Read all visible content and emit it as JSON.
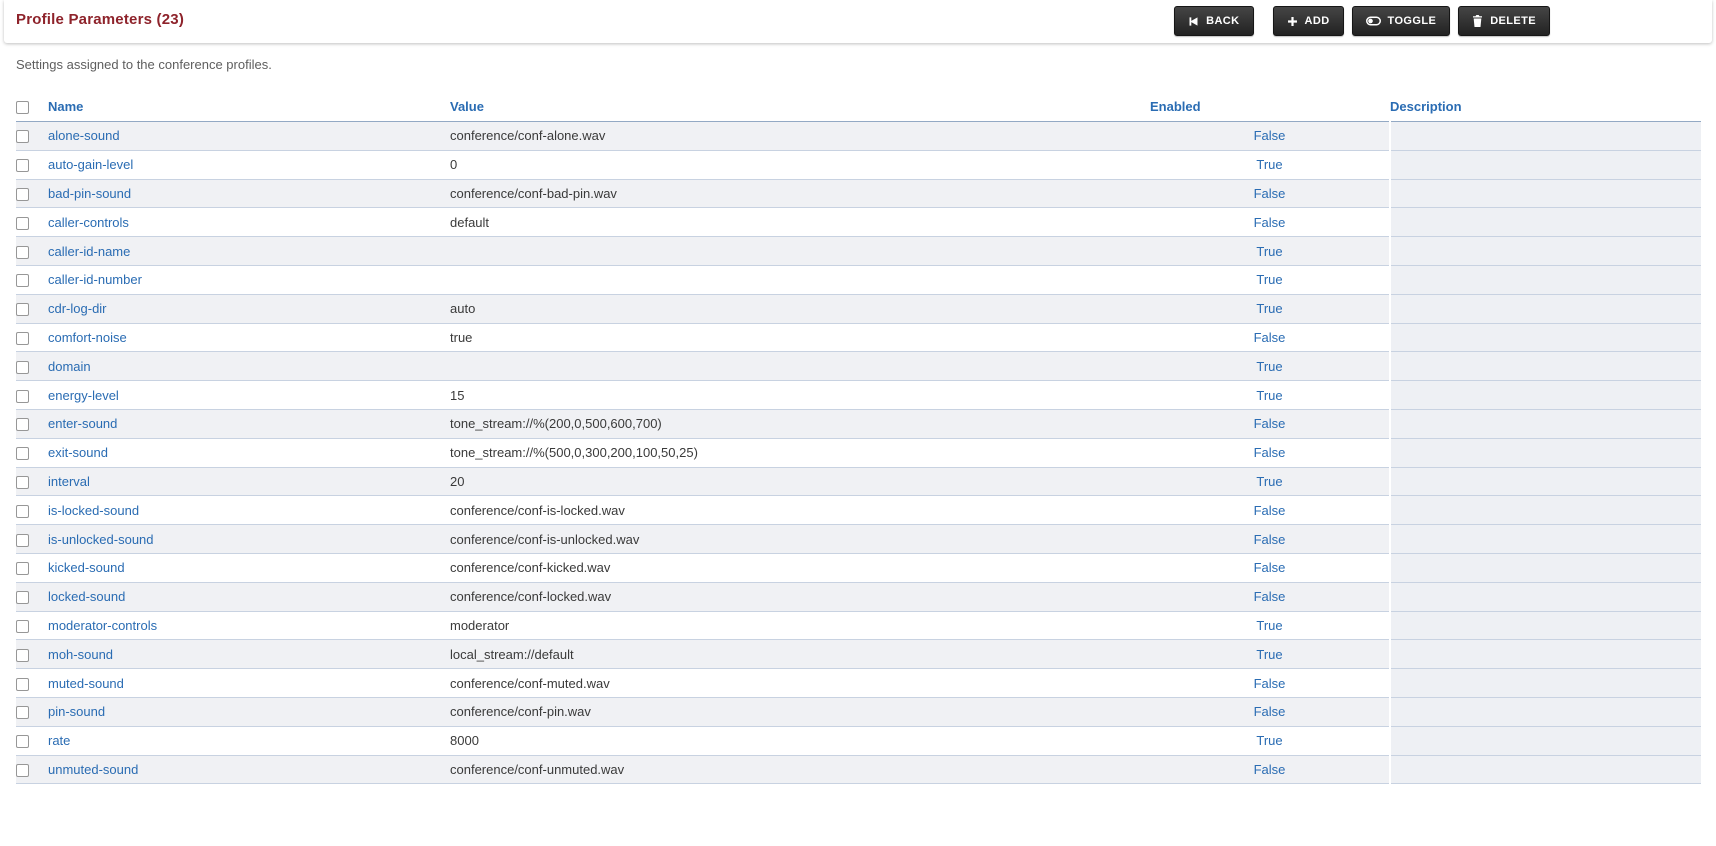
{
  "header": {
    "title": "Profile Parameters (23)",
    "buttons": [
      {
        "label": "BACK",
        "icon": "skip-back-icon"
      },
      {
        "label": "ADD",
        "icon": "plus-icon"
      },
      {
        "label": "TOGGLE",
        "icon": "toggle-icon"
      },
      {
        "label": "DELETE",
        "icon": "trash-icon"
      }
    ]
  },
  "subtitle": "Settings assigned to the conference profiles.",
  "table": {
    "columns": [
      "Name",
      "Value",
      "Enabled",
      "Description"
    ],
    "rows": [
      {
        "name": "alone-sound",
        "value": "conference/conf-alone.wav",
        "enabled": "False",
        "description": ""
      },
      {
        "name": "auto-gain-level",
        "value": "0",
        "enabled": "True",
        "description": ""
      },
      {
        "name": "bad-pin-sound",
        "value": "conference/conf-bad-pin.wav",
        "enabled": "False",
        "description": ""
      },
      {
        "name": "caller-controls",
        "value": "default",
        "enabled": "False",
        "description": ""
      },
      {
        "name": "caller-id-name",
        "value": "",
        "enabled": "True",
        "description": ""
      },
      {
        "name": "caller-id-number",
        "value": "",
        "enabled": "True",
        "description": ""
      },
      {
        "name": "cdr-log-dir",
        "value": "auto",
        "enabled": "True",
        "description": ""
      },
      {
        "name": "comfort-noise",
        "value": "true",
        "enabled": "False",
        "description": ""
      },
      {
        "name": "domain",
        "value": "",
        "enabled": "True",
        "description": ""
      },
      {
        "name": "energy-level",
        "value": "15",
        "enabled": "True",
        "description": ""
      },
      {
        "name": "enter-sound",
        "value": "tone_stream://%(200,0,500,600,700)",
        "enabled": "False",
        "description": ""
      },
      {
        "name": "exit-sound",
        "value": "tone_stream://%(500,0,300,200,100,50,25)",
        "enabled": "False",
        "description": ""
      },
      {
        "name": "interval",
        "value": "20",
        "enabled": "True",
        "description": ""
      },
      {
        "name": "is-locked-sound",
        "value": "conference/conf-is-locked.wav",
        "enabled": "False",
        "description": ""
      },
      {
        "name": "is-unlocked-sound",
        "value": "conference/conf-is-unlocked.wav",
        "enabled": "False",
        "description": ""
      },
      {
        "name": "kicked-sound",
        "value": "conference/conf-kicked.wav",
        "enabled": "False",
        "description": ""
      },
      {
        "name": "locked-sound",
        "value": "conference/conf-locked.wav",
        "enabled": "False",
        "description": ""
      },
      {
        "name": "moderator-controls",
        "value": "moderator",
        "enabled": "True",
        "description": ""
      },
      {
        "name": "moh-sound",
        "value": "local_stream://default",
        "enabled": "True",
        "description": ""
      },
      {
        "name": "muted-sound",
        "value": "conference/conf-muted.wav",
        "enabled": "False",
        "description": ""
      },
      {
        "name": "pin-sound",
        "value": "conference/conf-pin.wav",
        "enabled": "False",
        "description": ""
      },
      {
        "name": "rate",
        "value": "8000",
        "enabled": "True",
        "description": ""
      },
      {
        "name": "unmuted-sound",
        "value": "conference/conf-unmuted.wav",
        "enabled": "False",
        "description": ""
      }
    ]
  },
  "colors": {
    "title": "#8e232b",
    "link": "#2a6cb3",
    "header_link": "#2263ae",
    "button_bg": "#2d2d2d",
    "row_stripe": "#f0f1f4",
    "description_bg": "#eef0f4"
  }
}
